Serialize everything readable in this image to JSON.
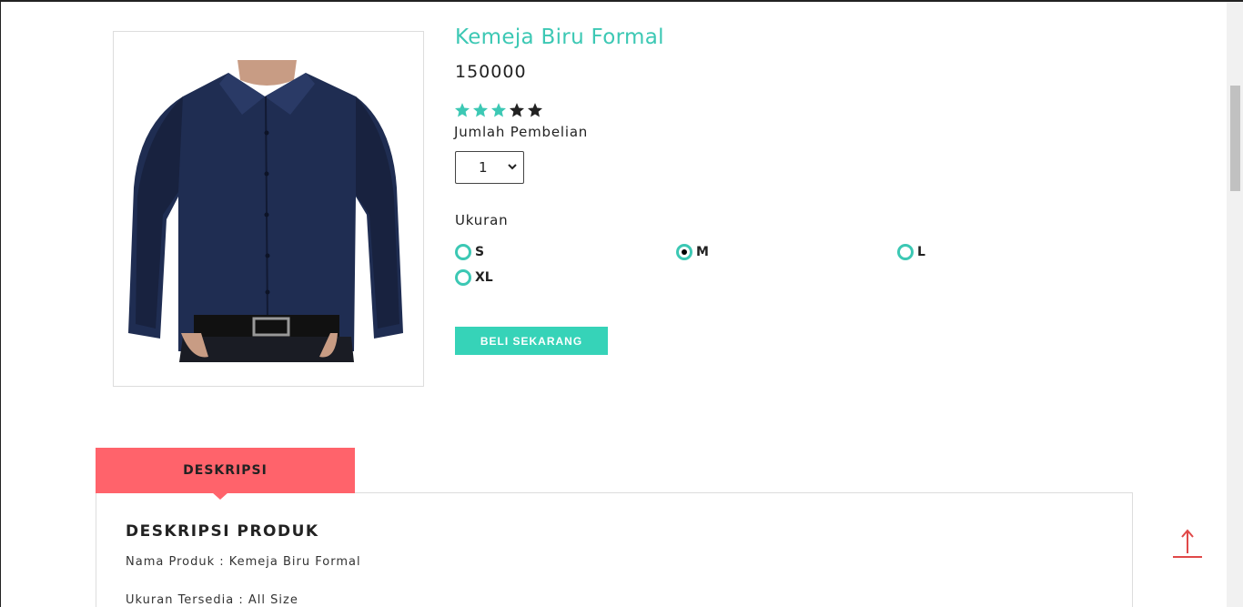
{
  "product": {
    "title": "Kemeja Biru Formal",
    "price": "150000",
    "rating": 3,
    "rating_max": 5,
    "image_icon": "shirt-image",
    "quantity_label": "Jumlah Pembelian",
    "quantity_value": "1",
    "size_label": "Ukuran",
    "sizes": [
      {
        "label": "S",
        "checked": false
      },
      {
        "label": "M",
        "checked": true
      },
      {
        "label": "L",
        "checked": false
      },
      {
        "label": "XL",
        "checked": false
      }
    ],
    "buy_label": "BELI SEKARANG"
  },
  "tabs": {
    "description_tab": "DESKRIPSI"
  },
  "description": {
    "heading": "DESKRIPSI PRODUK",
    "line1": "Nama Produk : Kemeja Biru Formal",
    "line2": "Ukuran Tersedia : All Size"
  },
  "colors": {
    "accent": "#3cc8b4",
    "button": "#36d3b8",
    "tab": "#ff636b",
    "star_empty": "#222222"
  },
  "icons": {
    "scroll_top": "arrow-up-icon",
    "select_chevron": "chevron-down-icon",
    "star": "star-icon"
  }
}
